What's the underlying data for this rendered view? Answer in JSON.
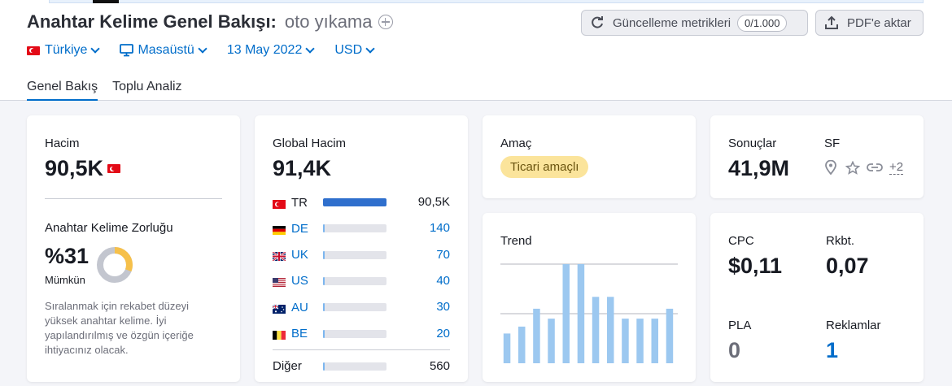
{
  "header": {
    "title": "Anahtar Kelime Genel Bakışı:",
    "keyword": "oto yıkama",
    "refresh_label": "Güncelleme metrikleri",
    "refresh_count": "0/1.000",
    "pdf_label": "PDF'e aktar"
  },
  "filters": {
    "country": "Türkiye",
    "device": "Masaüstü",
    "date": "13 May 2022",
    "currency": "USD"
  },
  "tabs": [
    {
      "label": "Genel Bakış",
      "active": true
    },
    {
      "label": "Toplu Analiz",
      "active": false
    }
  ],
  "volume": {
    "label": "Hacim",
    "value": "90,5K",
    "difficulty_label": "Anahtar Kelime Zorluğu",
    "difficulty_value": "%31",
    "difficulty_percent": 31,
    "difficulty_text": "Mümkün",
    "difficulty_desc": "Sıralanmak için rekabet düzeyi yüksek anahtar kelime. İyi yapılandırılmış ve özgün içeriğe ihtiyacınız olacak."
  },
  "global": {
    "label": "Global Hacim",
    "value": "91,4K",
    "countries": [
      {
        "code": "TR",
        "value": "90,5K",
        "fill": 1.0,
        "flag": "tr"
      },
      {
        "code": "DE",
        "value": "140",
        "fill": 0.03,
        "flag": "de"
      },
      {
        "code": "UK",
        "value": "70",
        "fill": 0.03,
        "flag": "uk"
      },
      {
        "code": "US",
        "value": "40",
        "fill": 0.03,
        "flag": "us"
      },
      {
        "code": "AU",
        "value": "30",
        "fill": 0.03,
        "flag": "au"
      },
      {
        "code": "BE",
        "value": "20",
        "fill": 0.03,
        "flag": "be"
      }
    ],
    "other_label": "Diğer",
    "other_value": "560",
    "other_fill": 0.03
  },
  "intent": {
    "label": "Amaç",
    "badge": "Ticari amaçlı"
  },
  "trend": {
    "label": "Trend",
    "values": [
      0.3,
      0.37,
      0.55,
      0.45,
      1.0,
      1.0,
      0.67,
      0.67,
      0.45,
      0.45,
      0.45,
      0.55
    ]
  },
  "results": {
    "label": "Sonuçlar",
    "value": "41,9M",
    "sf_label": "SF",
    "sf_more": "+2"
  },
  "cpc": {
    "cpc_label": "CPC",
    "cpc_value": "$0,11",
    "comp_label": "Rkbt.",
    "comp_value": "0,07",
    "pla_label": "PLA",
    "pla_value": "0",
    "ads_label": "Reklamlar",
    "ads_value": "1"
  },
  "colors": {
    "accent": "#006dca",
    "bar_dark": "#2f6fcd",
    "bar_light": "#9cc8f0",
    "difficulty": "#f6c04a",
    "badge": "#fbe49b"
  }
}
